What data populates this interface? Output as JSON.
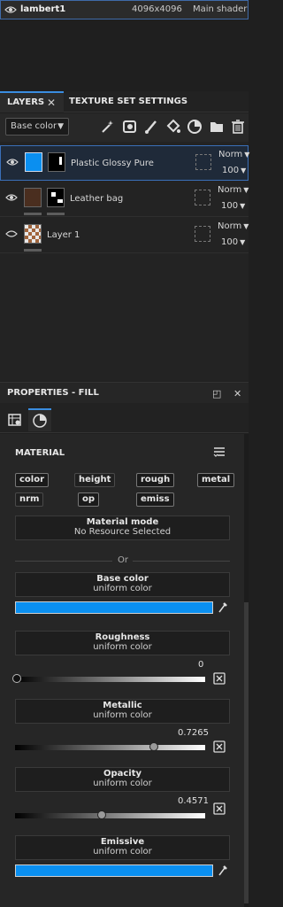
{
  "texture_set": {
    "name": "lambert1",
    "resolution": "4096x4096",
    "shader": "Main shader"
  },
  "tabs": {
    "layers": "LAYERS",
    "close": "✕",
    "texture_set_settings": "TEXTURE SET SETTINGS"
  },
  "toolbar": {
    "channel_select": "Base color"
  },
  "layers": [
    {
      "name": "Plastic Glossy Pure",
      "blend": "Norm",
      "opacity": "100",
      "selected": true
    },
    {
      "name": "Leather bag",
      "blend": "Norm",
      "opacity": "100",
      "selected": false
    },
    {
      "name": "Layer 1",
      "blend": "Norm",
      "opacity": "100",
      "selected": false
    }
  ],
  "properties": {
    "title": "PROPERTIES - FILL",
    "material_title": "MATERIAL",
    "channels": [
      {
        "label": "color",
        "enabled": true
      },
      {
        "label": "height",
        "enabled": false
      },
      {
        "label": "rough",
        "enabled": true
      },
      {
        "label": "metal",
        "enabled": true
      },
      {
        "label": "nrm",
        "enabled": false
      },
      {
        "label": "op",
        "enabled": true
      },
      {
        "label": "emiss",
        "enabled": true
      }
    ],
    "material_mode": {
      "title": "Material mode",
      "value": "No Resource Selected"
    },
    "or_label": "Or",
    "base_color": {
      "title": "Base color",
      "mode": "uniform color",
      "color": "#0a8ff0"
    },
    "roughness": {
      "title": "Roughness",
      "mode": "uniform color",
      "value": "0"
    },
    "metallic": {
      "title": "Metallic",
      "mode": "uniform color",
      "value": "0.7265"
    },
    "opacity": {
      "title": "Opacity",
      "mode": "uniform color",
      "value": "0.4571"
    },
    "emissive": {
      "title": "Emissive",
      "mode": "uniform color",
      "color": "#0a8ff0"
    }
  },
  "colors": {
    "accent": "#3a8de0",
    "selection_border": "#3a6fb8"
  }
}
